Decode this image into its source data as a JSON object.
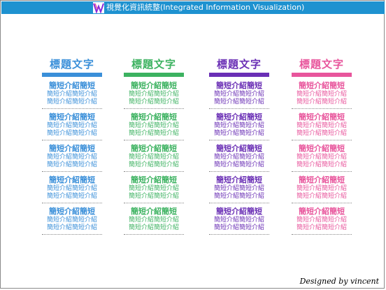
{
  "header": {
    "title": "視覺化資訊統整(Integrated Information Visualization)"
  },
  "colors": {
    "header_bg": "#1e92d0",
    "blue": "#3a8fd9",
    "green": "#3cb260",
    "purple": "#6a2fb5",
    "pink": "#e8559c"
  },
  "columns": [
    {
      "title": "標題文字",
      "color": "#3a8fd9",
      "items": [
        {
          "title": "簡短介紹簡短",
          "line1": "簡短介紹簡短介紹",
          "line2": "簡短介紹簡短介紹"
        },
        {
          "title": "簡短介紹簡短",
          "line1": "簡短介紹簡短介紹",
          "line2": "簡短介紹簡短介紹"
        },
        {
          "title": "簡短介紹簡短",
          "line1": "簡短介紹簡短介紹",
          "line2": "簡短介紹簡短介紹"
        },
        {
          "title": "簡短介紹簡短",
          "line1": "簡短介紹簡短介紹",
          "line2": "簡短介紹簡短介紹"
        },
        {
          "title": "簡短介紹簡短",
          "line1": "簡短介紹簡短介紹",
          "line2": "簡短介紹簡短介紹"
        }
      ]
    },
    {
      "title": "標題文字",
      "color": "#3cb260",
      "items": [
        {
          "title": "簡短介紹簡短",
          "line1": "簡短介紹簡短介紹",
          "line2": "簡短介紹簡短介紹"
        },
        {
          "title": "簡短介紹簡短",
          "line1": "簡短介紹簡短介紹",
          "line2": "簡短介紹簡短介紹"
        },
        {
          "title": "簡短介紹簡短",
          "line1": "簡短介紹簡短介紹",
          "line2": "簡短介紹簡短介紹"
        },
        {
          "title": "簡短介紹簡短",
          "line1": "簡短介紹簡短介紹",
          "line2": "簡短介紹簡短介紹"
        },
        {
          "title": "簡短介紹簡短",
          "line1": "簡短介紹簡短介紹",
          "line2": "簡短介紹簡短介紹"
        }
      ]
    },
    {
      "title": "標題文字",
      "color": "#6a2fb5",
      "items": [
        {
          "title": "簡短介紹簡短",
          "line1": "簡短介紹簡短介紹",
          "line2": "簡短介紹簡短介紹"
        },
        {
          "title": "簡短介紹簡短",
          "line1": "簡短介紹簡短介紹",
          "line2": "簡短介紹簡短介紹"
        },
        {
          "title": "簡短介紹簡短",
          "line1": "簡短介紹簡短介紹",
          "line2": "簡短介紹簡短介紹"
        },
        {
          "title": "簡短介紹簡短",
          "line1": "簡短介紹簡短介紹",
          "line2": "簡短介紹簡短介紹"
        },
        {
          "title": "簡短介紹簡短",
          "line1": "簡短介紹簡短介紹",
          "line2": "簡短介紹簡短介紹"
        }
      ]
    },
    {
      "title": "標題文字",
      "color": "#e8559c",
      "items": [
        {
          "title": "簡短介紹簡短",
          "line1": "簡短介紹簡短介紹",
          "line2": "簡短介紹簡短介紹"
        },
        {
          "title": "簡短介紹簡短",
          "line1": "簡短介紹簡短介紹",
          "line2": "簡短介紹簡短介紹"
        },
        {
          "title": "簡短介紹簡短",
          "line1": "簡短介紹簡短介紹",
          "line2": "簡短介紹簡短介紹"
        },
        {
          "title": "簡短介紹簡短",
          "line1": "簡短介紹簡短介紹",
          "line2": "簡短介紹簡短介紹"
        },
        {
          "title": "簡短介紹簡短",
          "line1": "簡短介紹簡短介紹",
          "line2": "簡短介紹簡短介紹"
        }
      ]
    }
  ],
  "footer": {
    "credit": "Designed by vincent"
  }
}
